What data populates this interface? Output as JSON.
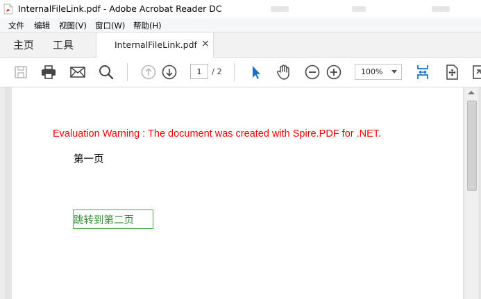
{
  "window": {
    "title": "InternalFileLink.pdf - Adobe Acrobat Reader DC"
  },
  "menu": {
    "items": [
      {
        "label": "文件"
      },
      {
        "label": "编辑"
      },
      {
        "label": "视图(V)"
      },
      {
        "label": "窗口(W)"
      },
      {
        "label": "帮助(H)"
      }
    ]
  },
  "tabs": {
    "home": "主页",
    "tools": "工具",
    "document": "InternalFileLink.pdf",
    "close_glyph": "×"
  },
  "toolbar": {
    "icons": [
      "save-icon",
      "print-icon",
      "email-icon",
      "search-icon",
      "previous-page-icon",
      "next-page-icon",
      "select-pointer-icon",
      "hand-tool-icon",
      "zoom-out-icon",
      "zoom-in-icon",
      "fit-page-icon",
      "rotate-view-icon",
      "more-tools-icon"
    ],
    "current_page": "1",
    "page_total": "/ 2",
    "zoom": "100%"
  },
  "document": {
    "warning": "Evaluation Warning : The document was created with Spire.PDF for .NET.",
    "heading": "第一页",
    "link_text": "跳转到第二页"
  },
  "colors": {
    "warning": "#ff0000",
    "link": "#2e8b2e",
    "link_border": "#44aa44",
    "accent": "#1a73c8"
  }
}
